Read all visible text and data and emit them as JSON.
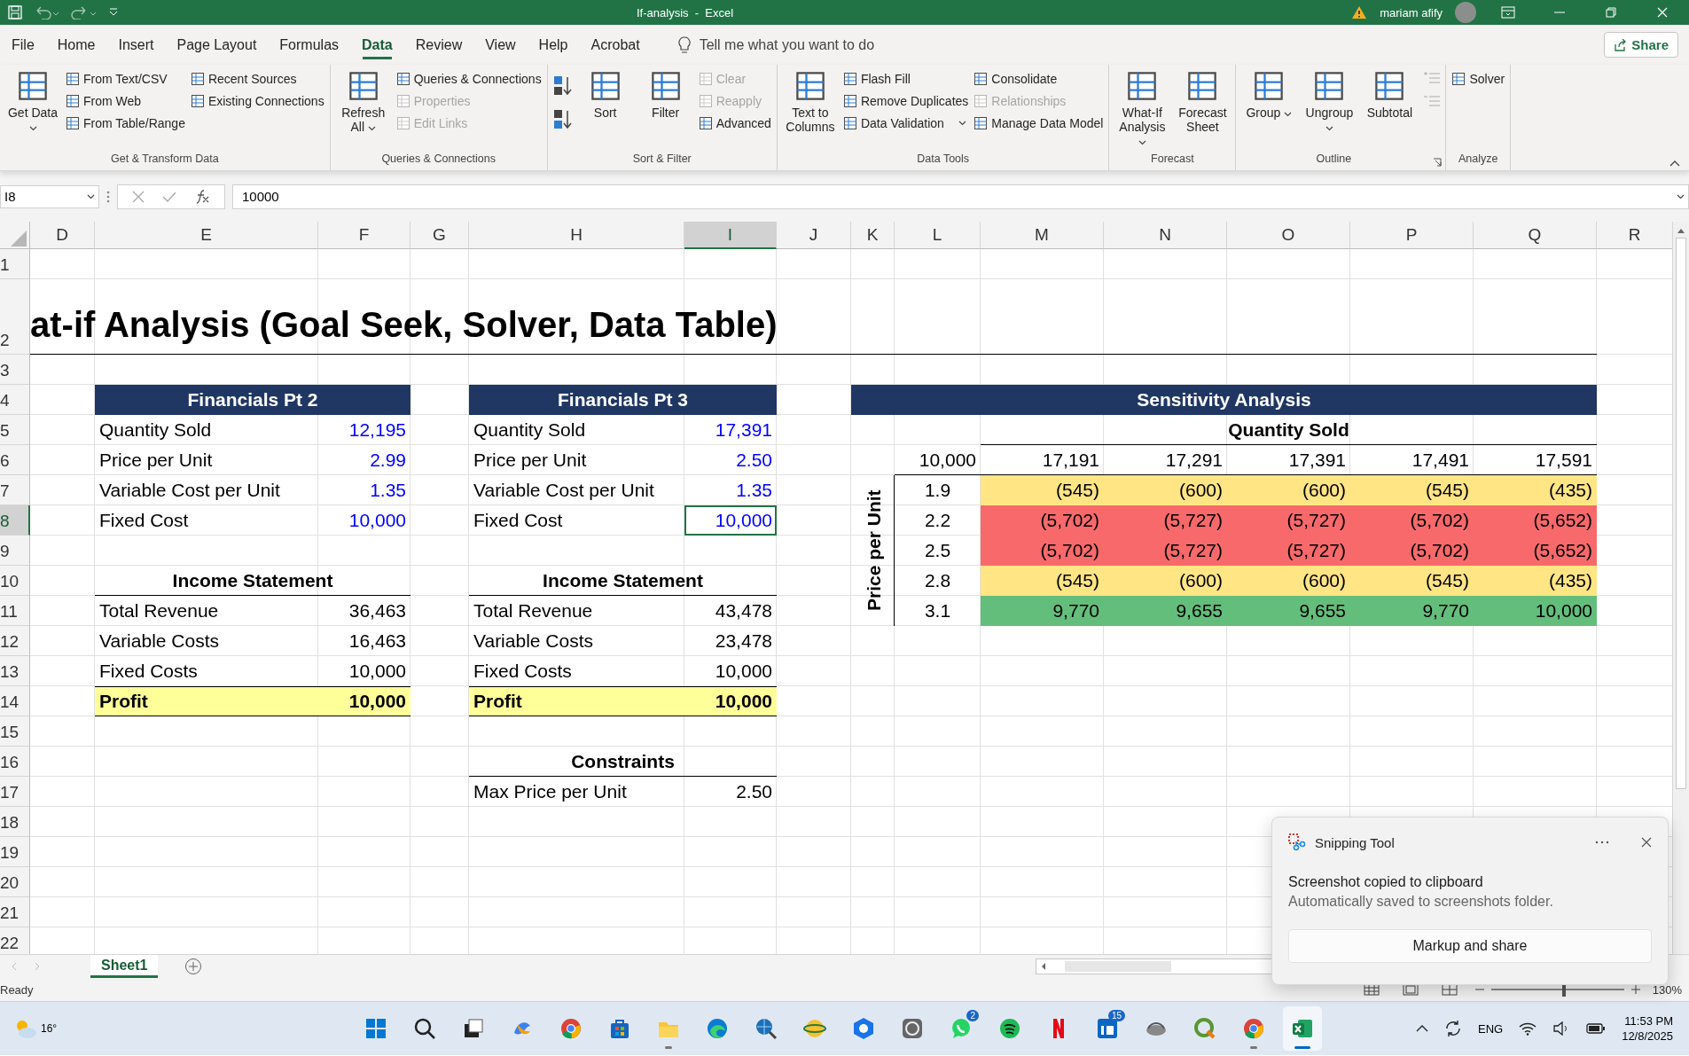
{
  "title_bar": {
    "title": "If-analysis  -  Excel",
    "user": "mariam afify"
  },
  "menu_tabs": [
    {
      "label": "File",
      "selected": false
    },
    {
      "label": "Home",
      "selected": false
    },
    {
      "label": "Insert",
      "selected": false
    },
    {
      "label": "Page Layout",
      "selected": false
    },
    {
      "label": "Formulas",
      "selected": false
    },
    {
      "label": "Data",
      "selected": true
    },
    {
      "label": "Review",
      "selected": false
    },
    {
      "label": "View",
      "selected": false
    },
    {
      "label": "Help",
      "selected": false
    },
    {
      "label": "Acrobat",
      "selected": false
    }
  ],
  "tell_me": "Tell me what you want to do",
  "share": "Share",
  "ribbon": [
    {
      "label": "Get & Transform Data",
      "columns": [
        {
          "kind": "large",
          "label": "Get Data",
          "dropdown": true
        },
        {
          "kind": "stack",
          "items": [
            {
              "label": "From Text/CSV",
              "disabled": false
            },
            {
              "label": "From Web",
              "disabled": false
            },
            {
              "label": "From Table/Range",
              "disabled": false
            }
          ]
        },
        {
          "kind": "stack",
          "items": [
            {
              "label": "Recent Sources",
              "disabled": false
            },
            {
              "label": "Existing Connections",
              "disabled": false
            }
          ]
        }
      ]
    },
    {
      "label": "Queries & Connections",
      "columns": [
        {
          "kind": "large",
          "label": "Refresh All",
          "dropdown": true
        },
        {
          "kind": "stack",
          "items": [
            {
              "label": "Queries & Connections",
              "disabled": false
            },
            {
              "label": "Properties",
              "disabled": true
            },
            {
              "label": "Edit Links",
              "disabled": true
            }
          ]
        }
      ]
    },
    {
      "label": "Sort & Filter",
      "columns": [
        {
          "kind": "sort_icons"
        },
        {
          "kind": "large",
          "label": "Sort",
          "dropdown": false
        },
        {
          "kind": "large",
          "label": "Filter",
          "dropdown": false
        },
        {
          "kind": "stack",
          "items": [
            {
              "label": "Clear",
              "disabled": true
            },
            {
              "label": "Reapply",
              "disabled": true
            },
            {
              "label": "Advanced",
              "disabled": false
            }
          ]
        }
      ]
    },
    {
      "label": "Data Tools",
      "columns": [
        {
          "kind": "large",
          "label": "Text to Columns",
          "dropdown": false
        },
        {
          "kind": "stack",
          "items": [
            {
              "label": "Flash Fill",
              "disabled": false
            },
            {
              "label": "Remove Duplicates",
              "disabled": false
            },
            {
              "label": "Data Validation",
              "disabled": false,
              "dropdown": true
            }
          ]
        },
        {
          "kind": "stack",
          "items": [
            {
              "label": "Consolidate",
              "disabled": false
            },
            {
              "label": "Relationships",
              "disabled": true
            },
            {
              "label": "Manage Data Model",
              "disabled": false
            }
          ]
        }
      ]
    },
    {
      "label": "Forecast",
      "columns": [
        {
          "kind": "large",
          "label": "What-If Analysis",
          "dropdown": true
        },
        {
          "kind": "large",
          "label": "Forecast Sheet",
          "dropdown": false
        }
      ]
    },
    {
      "label": "Outline",
      "launcher": true,
      "columns": [
        {
          "kind": "large",
          "label": "Group",
          "dropdown": true
        },
        {
          "kind": "large",
          "label": "Ungroup",
          "dropdown": true
        },
        {
          "kind": "large",
          "label": "Subtotal",
          "dropdown": false
        },
        {
          "kind": "outline_icons"
        }
      ]
    },
    {
      "label": "Analyze",
      "columns": [
        {
          "kind": "stack",
          "items": [
            {
              "label": "Solver",
              "disabled": false
            }
          ]
        }
      ]
    }
  ],
  "formula_bar": {
    "name_box": "I8",
    "value": "10000"
  },
  "columns": [
    {
      "label": "D",
      "selected": false
    },
    {
      "label": "E",
      "selected": false
    },
    {
      "label": "F",
      "selected": false
    },
    {
      "label": "G",
      "selected": false
    },
    {
      "label": "H",
      "selected": false
    },
    {
      "label": "I",
      "selected": true
    },
    {
      "label": "J",
      "selected": false
    },
    {
      "label": "K",
      "selected": false
    },
    {
      "label": "L",
      "selected": false
    },
    {
      "label": "M",
      "selected": false
    },
    {
      "label": "N",
      "selected": false
    },
    {
      "label": "O",
      "selected": false
    },
    {
      "label": "P",
      "selected": false
    },
    {
      "label": "Q",
      "selected": false
    },
    {
      "label": "R",
      "selected": false
    }
  ],
  "rows": [
    {
      "label": "1",
      "selected": false
    },
    {
      "label": "2",
      "selected": false
    },
    {
      "label": "3",
      "selected": false
    },
    {
      "label": "4",
      "selected": false
    },
    {
      "label": "5",
      "selected": false
    },
    {
      "label": "6",
      "selected": false
    },
    {
      "label": "7",
      "selected": false
    },
    {
      "label": "8",
      "selected": true
    },
    {
      "label": "9",
      "selected": false
    },
    {
      "label": "10",
      "selected": false
    },
    {
      "label": "11",
      "selected": false
    },
    {
      "label": "12",
      "selected": false
    },
    {
      "label": "13",
      "selected": false
    },
    {
      "label": "14",
      "selected": false
    },
    {
      "label": "15",
      "selected": false
    },
    {
      "label": "16",
      "selected": false
    },
    {
      "label": "17",
      "selected": false
    },
    {
      "label": "18",
      "selected": false
    },
    {
      "label": "19",
      "selected": false
    },
    {
      "label": "20",
      "selected": false
    },
    {
      "label": "21",
      "selected": false
    },
    {
      "label": "22",
      "selected": false
    }
  ],
  "sheet_title": "at-if Analysis (Goal Seek, Solver, Data Table)",
  "financials": [
    {
      "title": "Financials Pt 2",
      "inputs": [
        {
          "label": "Quantity Sold",
          "value": "12,195",
          "selected": false
        },
        {
          "label": "Price per Unit",
          "value": "2.99",
          "selected": false
        },
        {
          "label": "Variable Cost per Unit",
          "value": "1.35",
          "selected": false
        },
        {
          "label": "Fixed Cost",
          "value": "10,000",
          "selected": false
        }
      ],
      "income_title": "Income Statement",
      "income": [
        {
          "label": "Total Revenue",
          "value": "36,463"
        },
        {
          "label": "Variable Costs",
          "value": "16,463"
        },
        {
          "label": "Fixed Costs",
          "value": "10,000"
        }
      ],
      "profit": {
        "label": "Profit",
        "value": "10,000"
      }
    },
    {
      "title": "Financials Pt 3",
      "inputs": [
        {
          "label": "Quantity Sold",
          "value": "17,391",
          "selected": false
        },
        {
          "label": "Price per Unit",
          "value": "2.50",
          "selected": false
        },
        {
          "label": "Variable Cost per Unit",
          "value": "1.35",
          "selected": false
        },
        {
          "label": "Fixed Cost",
          "value": "10,000",
          "selected": true
        }
      ],
      "income_title": "Income Statement",
      "income": [
        {
          "label": "Total Revenue",
          "value": "43,478"
        },
        {
          "label": "Variable Costs",
          "value": "23,478"
        },
        {
          "label": "Fixed Costs",
          "value": "10,000"
        }
      ],
      "profit": {
        "label": "Profit",
        "value": "10,000"
      }
    }
  ],
  "constraints": {
    "title": "Constraints",
    "items": [
      {
        "label": "Max Price per Unit",
        "value": "2.50"
      }
    ]
  },
  "sensitivity": {
    "title": "Sensitivity Analysis",
    "column_title": "Quantity Sold",
    "row_title": "Price per Unit",
    "corner": "10,000",
    "columns": [
      "17,191",
      "17,291",
      "17,391",
      "17,491",
      "17,591"
    ],
    "rows": [
      {
        "label": "1.9",
        "cells": [
          {
            "text": "(545)",
            "color": "#ffe584"
          },
          {
            "text": "(600)",
            "color": "#ffe584"
          },
          {
            "text": "(600)",
            "color": "#ffe584"
          },
          {
            "text": "(545)",
            "color": "#ffe584"
          },
          {
            "text": "(435)",
            "color": "#ffe584"
          }
        ]
      },
      {
        "label": "2.2",
        "cells": [
          {
            "text": "(5,702)",
            "color": "#f8696b"
          },
          {
            "text": "(5,727)",
            "color": "#f8696b"
          },
          {
            "text": "(5,727)",
            "color": "#f8696b"
          },
          {
            "text": "(5,702)",
            "color": "#f8696b"
          },
          {
            "text": "(5,652)",
            "color": "#f8696b"
          }
        ]
      },
      {
        "label": "2.5",
        "cells": [
          {
            "text": "(5,702)",
            "color": "#f8696b"
          },
          {
            "text": "(5,727)",
            "color": "#f8696b"
          },
          {
            "text": "(5,727)",
            "color": "#f8696b"
          },
          {
            "text": "(5,702)",
            "color": "#f8696b"
          },
          {
            "text": "(5,652)",
            "color": "#f8696b"
          }
        ]
      },
      {
        "label": "2.8",
        "cells": [
          {
            "text": "(545)",
            "color": "#ffe584"
          },
          {
            "text": "(600)",
            "color": "#ffe584"
          },
          {
            "text": "(600)",
            "color": "#ffe584"
          },
          {
            "text": "(545)",
            "color": "#ffe584"
          },
          {
            "text": "(435)",
            "color": "#ffe584"
          }
        ]
      },
      {
        "label": "3.1",
        "cells": [
          {
            "text": "9,770",
            "color": "#63be7b"
          },
          {
            "text": "9,655",
            "color": "#63be7b"
          },
          {
            "text": "9,655",
            "color": "#63be7b"
          },
          {
            "text": "9,770",
            "color": "#63be7b"
          },
          {
            "text": "10,000",
            "color": "#63be7b"
          }
        ]
      }
    ]
  },
  "sheet_tabs": [
    {
      "label": "Sheet1",
      "selected": true
    }
  ],
  "status_bar": {
    "text": "Ready",
    "zoom": "130%",
    "zoom_slider": {
      "level": 0.55
    }
  },
  "notification": {
    "app": "Snipping Tool",
    "title": "Screenshot copied to clipboard",
    "body": "Automatically saved to screenshots folder.",
    "button": "Markup and share"
  },
  "taskbar": {
    "weather": "16°",
    "apps": [
      {
        "kind": "start",
        "running": false,
        "selected": false
      },
      {
        "kind": "search",
        "running": false,
        "selected": false
      },
      {
        "kind": "taskview",
        "running": false,
        "selected": false
      },
      {
        "kind": "copilot",
        "running": false,
        "selected": false
      },
      {
        "kind": "chrome",
        "running": false,
        "selected": false
      },
      {
        "kind": "store",
        "running": false,
        "selected": false
      },
      {
        "kind": "folder",
        "running": true,
        "selected": false
      },
      {
        "kind": "edge",
        "running": false,
        "selected": false
      },
      {
        "kind": "globe",
        "running": false,
        "selected": false
      },
      {
        "kind": "sphere",
        "running": false,
        "selected": false
      },
      {
        "kind": "hexagon",
        "running": false,
        "selected": false
      },
      {
        "kind": "gear",
        "running": false,
        "selected": false
      },
      {
        "kind": "chat",
        "running": false,
        "selected": false,
        "badge": "2"
      },
      {
        "kind": "music",
        "running": false,
        "selected": false
      },
      {
        "kind": "redbar",
        "running": false,
        "selected": false
      },
      {
        "kind": "square",
        "running": false,
        "selected": false,
        "badge": "15"
      },
      {
        "kind": "cloud",
        "running": false,
        "selected": false
      },
      {
        "kind": "qgis",
        "running": false,
        "selected": false
      },
      {
        "kind": "chrome",
        "running": true,
        "selected": false
      },
      {
        "kind": "excel",
        "running": true,
        "selected": true
      }
    ],
    "language": "ENG",
    "time": "11:53 PM",
    "date": "12/8/2025"
  }
}
